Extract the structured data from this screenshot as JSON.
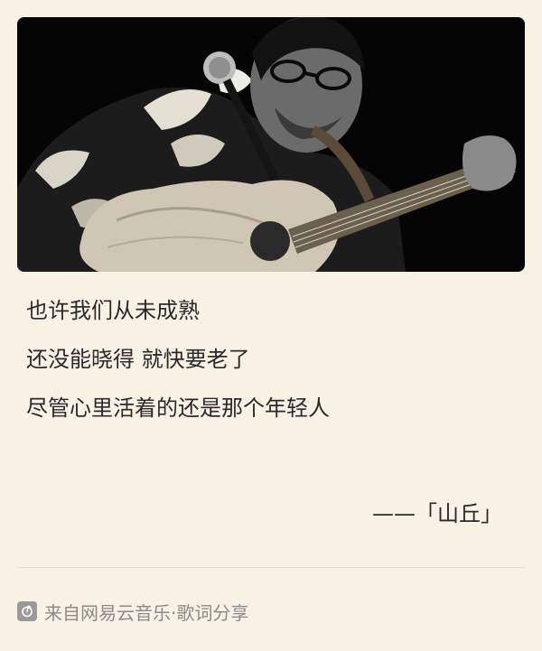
{
  "lyrics": {
    "lines": [
      "也许我们从未成熟",
      "还没能晓得 就快要老了",
      "尽管心里活着的还是那个年轻人"
    ],
    "song": "——「山丘」"
  },
  "footer": {
    "text": "来自网易云音乐·歌词分享",
    "logo_icon": "netease-music-icon"
  },
  "photo": {
    "description_icon": "singer-with-guitar-photo"
  },
  "colors": {
    "background": "#f7f2e4",
    "text": "#2a2a2a",
    "footer_text": "#8a8a8a"
  }
}
